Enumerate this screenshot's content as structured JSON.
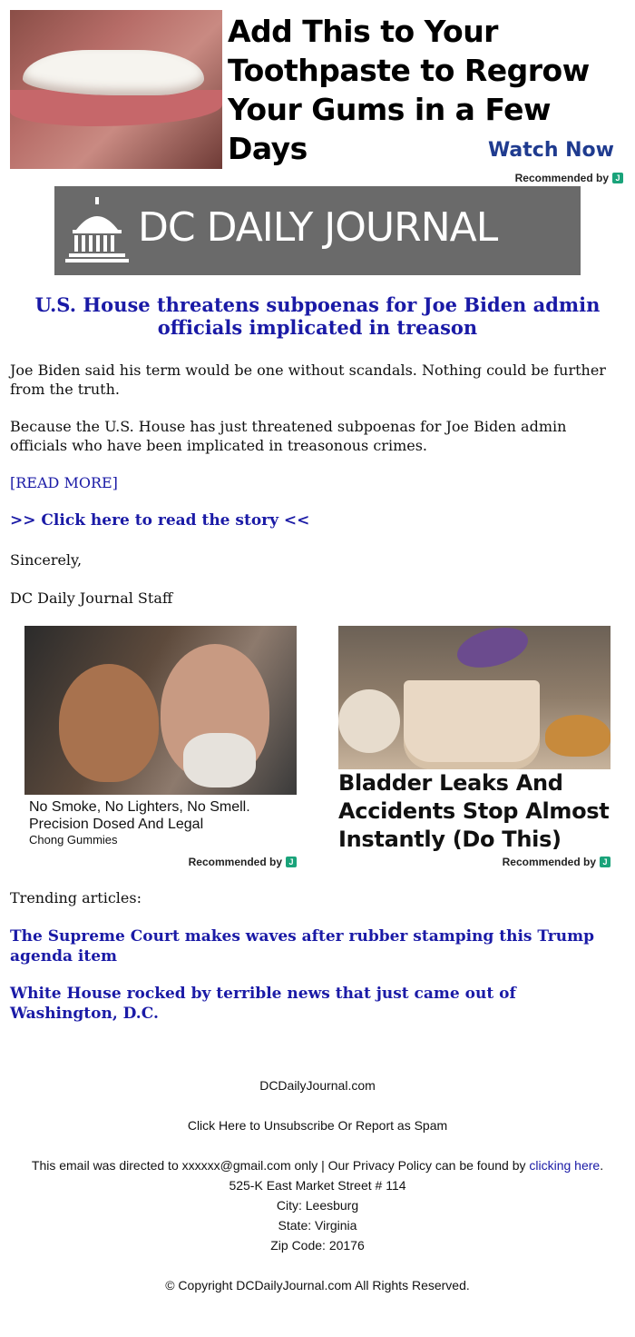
{
  "top_ad": {
    "headline": "Add This to Your Toothpaste to Regrow Your Gums in a Few Days",
    "cta": "Watch Now",
    "recommended": "Recommended by",
    "badge": "J"
  },
  "banner": {
    "title": "DC DAILY JOURNAL"
  },
  "article": {
    "headline": "U.S. House threatens subpoenas for Joe Biden admin officials implicated in treason",
    "p1": "Joe Biden said his term would be one without scandals. Nothing could be further from the truth.",
    "p2": "Because the U.S. House has just threatened subpoenas for Joe Biden admin officials who have been implicated in treasonous crimes.",
    "read_more": "[READ MORE]",
    "click_here": ">> Click here to read the story <<",
    "sincerely": "Sincerely,",
    "signature": "DC Daily Journal Staff"
  },
  "ads": {
    "left": {
      "caption": "No Smoke, No Lighters, No Smell. Precision Dosed And Legal",
      "brand": "Chong Gummies",
      "recommended": "Recommended by",
      "badge": "J"
    },
    "right": {
      "headline": "Bladder Leaks And Accidents Stop Almost Instantly (Do This)",
      "recommended": "Recommended by",
      "badge": "J"
    }
  },
  "trending": {
    "label": "Trending articles:",
    "items": [
      "The Supreme Court makes waves after rubber stamping this Trump agenda item",
      "White House rocked by terrible news that just came out of Washington, D.C."
    ]
  },
  "footer": {
    "site": "DCDailyJournal.com",
    "unsubscribe": "Click Here to Unsubscribe Or Report as Spam",
    "privacy_prefix": "This email was directed to xxxxxx@gmail.com only | Our Privacy Policy can be found by ",
    "privacy_link": "clicking here",
    "privacy_suffix": ".",
    "address": "525-K East Market Street # 114",
    "city": "City: Leesburg",
    "state": "State: Virginia",
    "zip": "Zip Code: 20176",
    "copyright": "© Copyright DCDailyJournal.com All Rights Reserved."
  }
}
